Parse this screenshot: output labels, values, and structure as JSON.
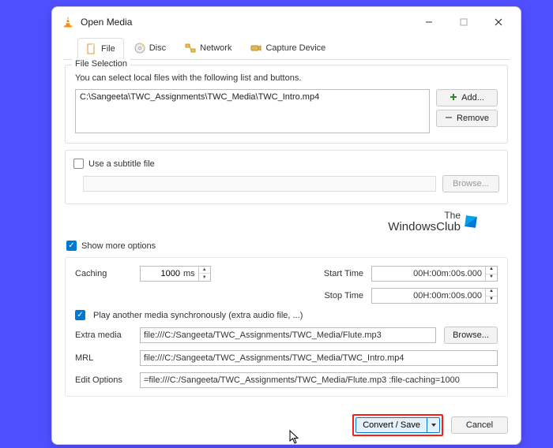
{
  "window": {
    "title": "Open Media"
  },
  "tabs": {
    "file": "File",
    "disc": "Disc",
    "network": "Network",
    "capture": "Capture Device"
  },
  "file_selection": {
    "title": "File Selection",
    "hint": "You can select local files with the following list and buttons.",
    "files": [
      "C:\\Sangeeta\\TWC_Assignments\\TWC_Media\\TWC_Intro.mp4"
    ],
    "add": "Add...",
    "remove": "Remove"
  },
  "subtitle": {
    "label": "Use a subtitle file",
    "browse": "Browse..."
  },
  "watermark": {
    "line1": "The",
    "line2": "WindowsClub"
  },
  "showmore": "Show more options",
  "opts": {
    "caching_label": "Caching",
    "caching_value": "1000",
    "caching_unit": "ms",
    "start_label": "Start Time",
    "start_value": "00H:00m:00s.000",
    "stop_label": "Stop Time",
    "stop_value": "00H:00m:00s.000",
    "sync_label": "Play another media synchronously (extra audio file, ...)",
    "extra_label": "Extra media",
    "extra_value": "file:///C:/Sangeeta/TWC_Assignments/TWC_Media/Flute.mp3",
    "browse": "Browse...",
    "mrl_label": "MRL",
    "mrl_value": "file:///C:/Sangeeta/TWC_Assignments/TWC_Media/TWC_Intro.mp4",
    "edit_label": "Edit Options",
    "edit_value": "=file:///C:/Sangeeta/TWC_Assignments/TWC_Media/Flute.mp3 :file-caching=1000"
  },
  "footer": {
    "convert": "Convert / Save",
    "cancel": "Cancel"
  }
}
